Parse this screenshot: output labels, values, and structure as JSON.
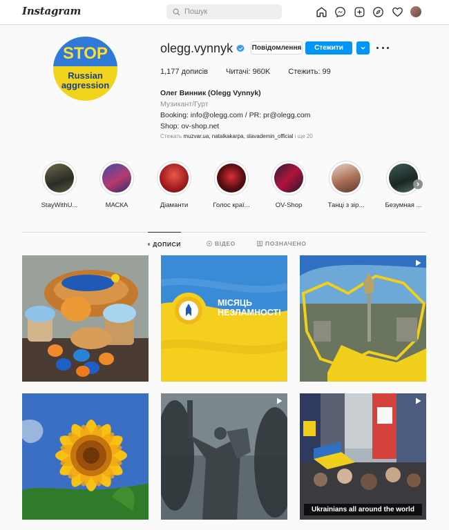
{
  "nav": {
    "logo": "Instagram",
    "search_placeholder": "Пошук",
    "icons": [
      "home-icon",
      "messenger-icon",
      "new-post-icon",
      "explore-icon",
      "activity-heart-icon",
      "profile-avatar"
    ]
  },
  "profile": {
    "pic": {
      "stop": "STOP",
      "line1": "Russian",
      "line2": "aggression"
    },
    "username": "olegg.vynnyk",
    "verified": true,
    "message_button": "Повідомлення",
    "follow_button": "Стежити",
    "stats": {
      "posts": "1,177 дописів",
      "followers": "Читачі: 960K",
      "following": "Стежить: 99"
    },
    "bio": {
      "name": "Олег Винник (Olegg Vynnyk)",
      "category": "Музикант/Гурт",
      "line1": "Booking: info@olegg.com / PR: pr@olegg.com",
      "line2": "Shop: ov-shop.net"
    },
    "followed_by": {
      "prefix": "Стежать",
      "names": "muzvar.ua, natalkakarpa, slavademin_official",
      "suffix": "і ще 20"
    }
  },
  "highlights": [
    {
      "label": "StayWithU..."
    },
    {
      "label": "МАСКА"
    },
    {
      "label": "Діаманти"
    },
    {
      "label": "Голос краї..."
    },
    {
      "label": "OV-Shop"
    },
    {
      "label": "Танці з зір..."
    },
    {
      "label": "Безумная ..."
    }
  ],
  "tabs": [
    {
      "label": "ДОПИСИ",
      "active": true
    },
    {
      "label": "ВІДЕО",
      "active": false
    },
    {
      "label": "ПОЗНАЧЕНО",
      "active": false
    }
  ],
  "posts": [
    {
      "name": "post-easter-bread",
      "reel": false,
      "caption": ""
    },
    {
      "name": "post-independence-month",
      "reel": false,
      "caption": "",
      "text1": "МІСЯЦЬ",
      "text2": "НЕЗЛАМНОСТІ"
    },
    {
      "name": "post-kyiv-monument",
      "reel": true,
      "caption": ""
    },
    {
      "name": "post-sunflower",
      "reel": false,
      "caption": ""
    },
    {
      "name": "post-motherland-statue",
      "reel": true,
      "caption": ""
    },
    {
      "name": "post-ukrainians-rally",
      "reel": true,
      "caption": "Ukrainians all around the world"
    }
  ],
  "colors": {
    "accent": "#0095f6",
    "text": "#262626",
    "muted": "#8e8e8e",
    "border": "#dbdbdb",
    "ukraine_blue": "#2f7ad6",
    "ukraine_yellow": "#f2d41c"
  }
}
